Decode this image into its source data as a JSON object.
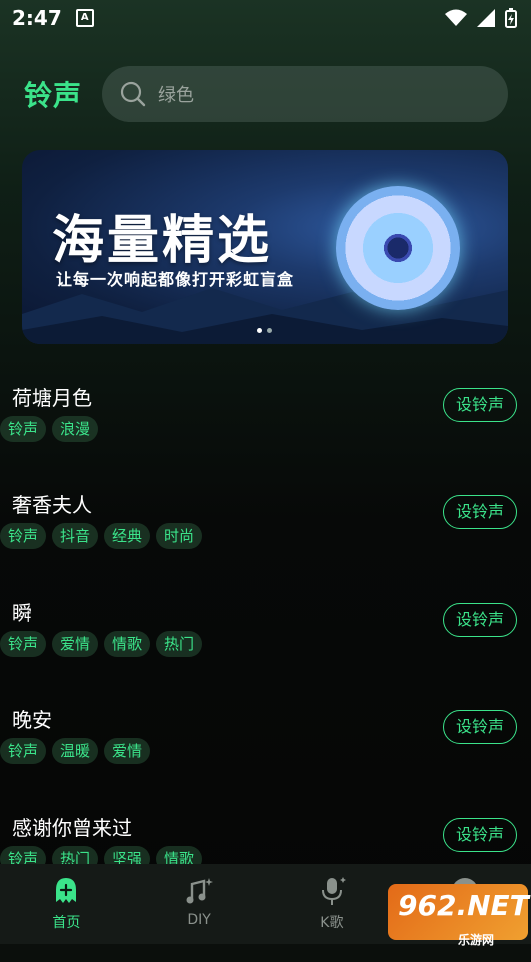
{
  "status_bar": {
    "time": "2:47",
    "notification_icon": "A"
  },
  "header": {
    "title": "铃声",
    "search_placeholder": "绿色"
  },
  "banner": {
    "title": "海量精选",
    "subtitle": "让每一次响起都像打开彩虹盲盒",
    "page_count": 2,
    "active_page": 1
  },
  "set_button_label": "设铃声",
  "songs": [
    {
      "name": "荷塘月色",
      "tags": [
        "铃声",
        "浪漫"
      ]
    },
    {
      "name": "奢香夫人",
      "tags": [
        "铃声",
        "抖音",
        "经典",
        "时尚"
      ]
    },
    {
      "name": "瞬",
      "tags": [
        "铃声",
        "爱情",
        "情歌",
        "热门"
      ]
    },
    {
      "name": "晚安",
      "tags": [
        "铃声",
        "温暖",
        "爱情"
      ]
    },
    {
      "name": "感谢你曾来过",
      "tags": [
        "铃声",
        "热门",
        "坚强",
        "情歌"
      ]
    }
  ],
  "nav": [
    {
      "label": "首页",
      "icon": "ghost-icon",
      "active": true
    },
    {
      "label": "DIY",
      "icon": "music-note-icon",
      "active": false
    },
    {
      "label": "K歌",
      "icon": "microphone-icon",
      "active": false
    },
    {
      "label": "",
      "icon": "smiley-icon",
      "active": false
    }
  ],
  "watermark": {
    "brand": "962.NET",
    "sub": "乐游网"
  },
  "colors": {
    "accent": "#3be38a",
    "background": "#0b0f0c",
    "nav_bg": "#151a17"
  }
}
